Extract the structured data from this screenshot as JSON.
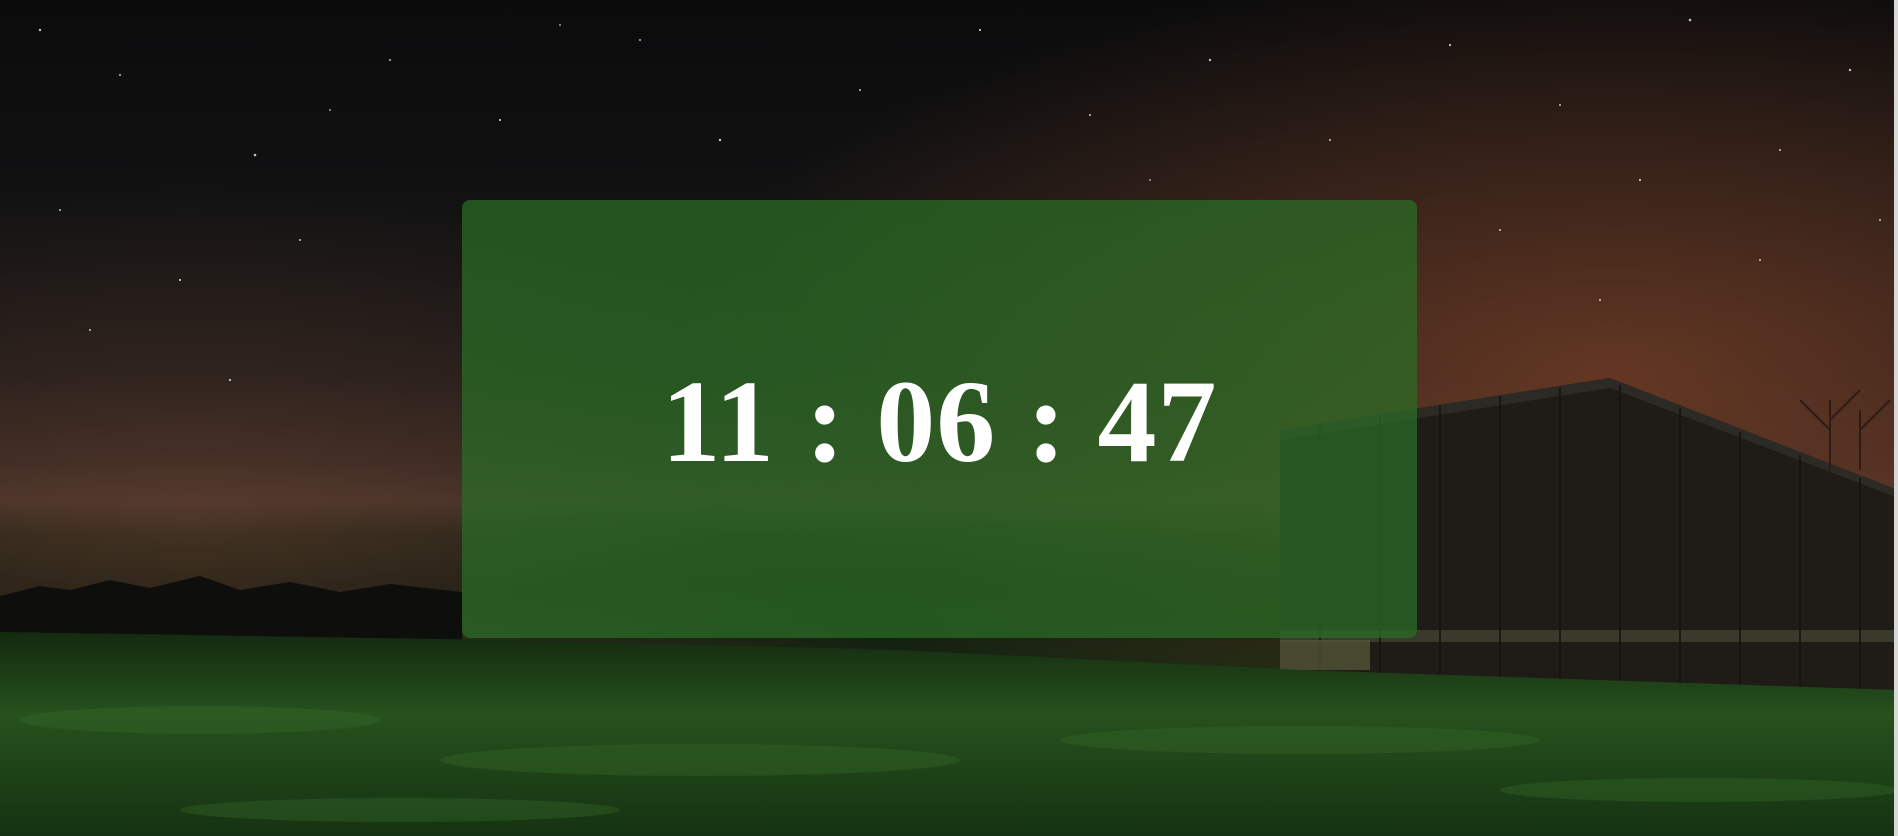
{
  "clock": {
    "hours": "11",
    "minutes": "06",
    "seconds": "47",
    "separator": " : "
  },
  "colors": {
    "panel": "#2a6e26",
    "text": "#ffffff",
    "sky": "#0b0b0c",
    "horizon_glow": "#8a4a2e",
    "grass": "#1f4a1a"
  }
}
